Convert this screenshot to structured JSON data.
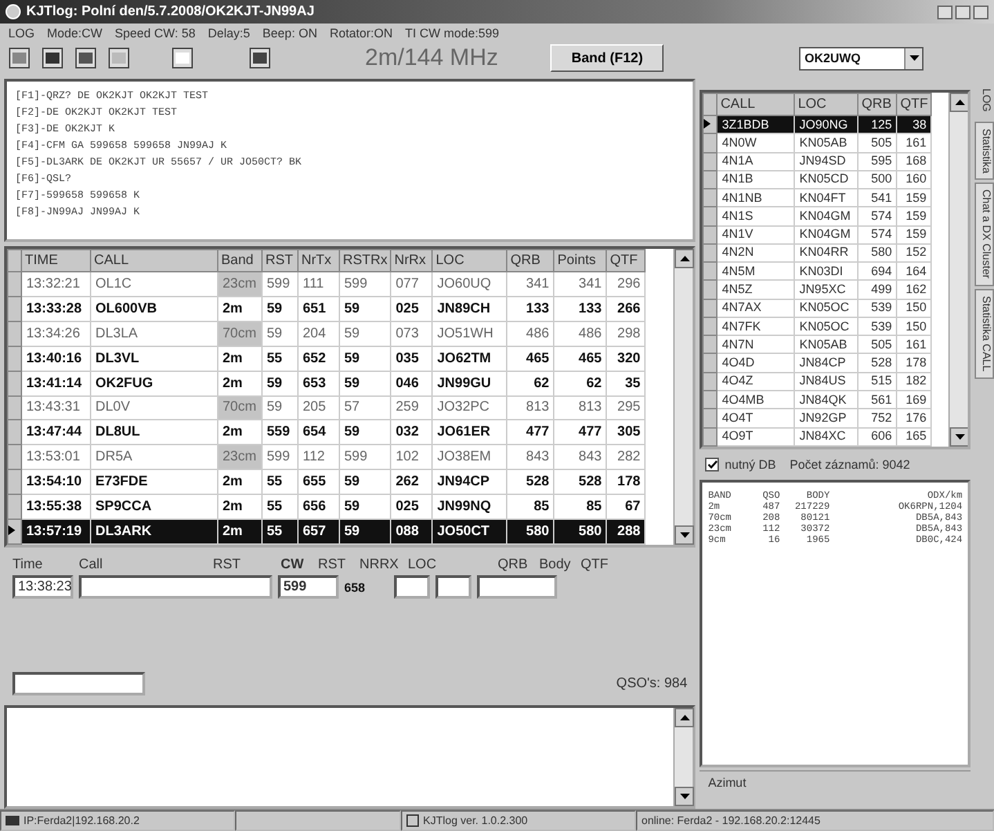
{
  "window": {
    "title": "KJTlog: Polní den/5.7.2008/OK2KJT-JN99AJ"
  },
  "menu": [
    "LOG",
    "Mode:CW",
    "Speed CW: 58",
    "Delay:5",
    "Beep: ON",
    "Rotator:ON",
    "TI CW mode:599"
  ],
  "toolbar": {
    "band_label": "2m/144 MHz",
    "band_button": "Band (F12)",
    "operator": "OK2UWQ"
  },
  "macros": [
    "[F1]-QRZ? DE OK2KJT OK2KJT TEST",
    "[F2]-DE OK2KJT OK2KJT TEST",
    "[F3]-DE OK2KJT K",
    "[F4]-CFM GA 599658 599658 JN99AJ K",
    "[F5]-DL3ARK DE OK2KJT UR 55657 / UR JO50CT? BK",
    "[F6]-QSL?",
    "[F7]-599658 599658 K",
    "[F8]-JN99AJ JN99AJ K"
  ],
  "log": {
    "columns": [
      "TIME",
      "CALL",
      "Band",
      "RST",
      "NrTx",
      "RSTRx",
      "NrRx",
      "LOC",
      "QRB",
      "Points",
      "QTF"
    ],
    "rows": [
      {
        "cells": [
          "13:32:21",
          "OL1C",
          "23cm",
          "599",
          "111",
          "599",
          "077",
          "JO60UQ",
          "341",
          "341",
          "296"
        ],
        "greyed": true,
        "selected": false
      },
      {
        "cells": [
          "13:33:28",
          "OL600VB",
          "2m",
          "59",
          "651",
          "59",
          "025",
          "JN89CH",
          "133",
          "133",
          "266"
        ],
        "greyed": false,
        "selected": false
      },
      {
        "cells": [
          "13:34:26",
          "DL3LA",
          "70cm",
          "59",
          "204",
          "59",
          "073",
          "JO51WH",
          "486",
          "486",
          "298"
        ],
        "greyed": true,
        "selected": false
      },
      {
        "cells": [
          "13:40:16",
          "DL3VL",
          "2m",
          "55",
          "652",
          "59",
          "035",
          "JO62TM",
          "465",
          "465",
          "320"
        ],
        "greyed": false,
        "selected": false
      },
      {
        "cells": [
          "13:41:14",
          "OK2FUG",
          "2m",
          "59",
          "653",
          "59",
          "046",
          "JN99GU",
          "62",
          "62",
          "35"
        ],
        "greyed": false,
        "selected": false
      },
      {
        "cells": [
          "13:43:31",
          "DL0V",
          "70cm",
          "59",
          "205",
          "57",
          "259",
          "JO32PC",
          "813",
          "813",
          "295"
        ],
        "greyed": true,
        "selected": false
      },
      {
        "cells": [
          "13:47:44",
          "DL8UL",
          "2m",
          "559",
          "654",
          "59",
          "032",
          "JO61ER",
          "477",
          "477",
          "305"
        ],
        "greyed": false,
        "selected": false
      },
      {
        "cells": [
          "13:53:01",
          "DR5A",
          "23cm",
          "599",
          "112",
          "599",
          "102",
          "JO38EM",
          "843",
          "843",
          "282"
        ],
        "greyed": true,
        "selected": false
      },
      {
        "cells": [
          "13:54:10",
          "E73FDE",
          "2m",
          "55",
          "655",
          "59",
          "262",
          "JN94CP",
          "528",
          "528",
          "178"
        ],
        "greyed": false,
        "selected": false
      },
      {
        "cells": [
          "13:55:38",
          "SP9CCA",
          "2m",
          "55",
          "656",
          "59",
          "025",
          "JN99NQ",
          "85",
          "85",
          "67"
        ],
        "greyed": false,
        "selected": false
      },
      {
        "cells": [
          "13:57:19",
          "DL3ARK",
          "2m",
          "55",
          "657",
          "59",
          "088",
          "JO50CT",
          "580",
          "580",
          "288"
        ],
        "greyed": false,
        "selected": true
      }
    ]
  },
  "entry": {
    "labels": [
      "Time",
      "Call",
      "RST",
      "CW",
      "RST",
      "NRRX",
      "LOC",
      "QRB",
      "Body",
      "QTF"
    ],
    "time": "13:38:23",
    "rst": "599",
    "nr_tx": "658",
    "qso_count": "QSO's: 984"
  },
  "calls": {
    "columns": [
      "CALL",
      "LOC",
      "QRB",
      "QTF"
    ],
    "rows": [
      {
        "cells": [
          "3Z1BDB",
          "JO90NG",
          "125",
          "38"
        ],
        "selected": true
      },
      {
        "cells": [
          "4N0W",
          "KN05AB",
          "505",
          "161"
        ],
        "selected": false
      },
      {
        "cells": [
          "4N1A",
          "JN94SD",
          "595",
          "168"
        ],
        "selected": false
      },
      {
        "cells": [
          "4N1B",
          "KN05CD",
          "500",
          "160"
        ],
        "selected": false
      },
      {
        "cells": [
          "4N1NB",
          "KN04FT",
          "541",
          "159"
        ],
        "selected": false
      },
      {
        "cells": [
          "4N1S",
          "KN04GM",
          "574",
          "159"
        ],
        "selected": false
      },
      {
        "cells": [
          "4N1V",
          "KN04GM",
          "574",
          "159"
        ],
        "selected": false
      },
      {
        "cells": [
          "4N2N",
          "KN04RR",
          "580",
          "152"
        ],
        "selected": false
      },
      {
        "cells": [
          "4N5M",
          "KN03DI",
          "694",
          "164"
        ],
        "selected": false
      },
      {
        "cells": [
          "4N5Z",
          "JN95XC",
          "499",
          "162"
        ],
        "selected": false
      },
      {
        "cells": [
          "4N7AX",
          "KN05OC",
          "539",
          "150"
        ],
        "selected": false
      },
      {
        "cells": [
          "4N7FK",
          "KN05OC",
          "539",
          "150"
        ],
        "selected": false
      },
      {
        "cells": [
          "4N7N",
          "KN05AB",
          "505",
          "161"
        ],
        "selected": false
      },
      {
        "cells": [
          "4O4D",
          "JN84CP",
          "528",
          "178"
        ],
        "selected": false
      },
      {
        "cells": [
          "4O4Z",
          "JN84US",
          "515",
          "182"
        ],
        "selected": false
      },
      {
        "cells": [
          "4O4MB",
          "JN84QK",
          "561",
          "169"
        ],
        "selected": false
      },
      {
        "cells": [
          "4O4T",
          "JN92GP",
          "752",
          "176"
        ],
        "selected": false
      },
      {
        "cells": [
          "4O9T",
          "JN84XC",
          "606",
          "165"
        ],
        "selected": false
      }
    ]
  },
  "db": {
    "label": "nutný DB",
    "checked": true,
    "count": "Počet záznamů: 9042"
  },
  "stats": {
    "columns": [
      "BAND",
      "QSO",
      "BODY",
      "ODX/km"
    ],
    "rows": [
      [
        "2m",
        "487",
        "217229",
        "OK6RPN,1204"
      ],
      [
        "70cm",
        "208",
        "80121",
        "DB5A,843"
      ],
      [
        "23cm",
        "112",
        "30372",
        "DB5A,843"
      ],
      [
        "9cm",
        "16",
        "1965",
        "DB0C,424"
      ]
    ]
  },
  "azimuth": "Azimut",
  "side_tabs": [
    {
      "label": "LOG",
      "selected": true
    },
    {
      "label": "Statistika",
      "selected": false
    },
    {
      "label": "Chat a DX Cluster",
      "selected": false
    },
    {
      "label": "Statistika CALL",
      "selected": false
    }
  ],
  "status_bar": [
    "IP:Ferda2|192.168.20.2",
    "KJTlog ver. 1.0.2.300",
    "online: Ferda2 - 192.168.20.2:12445"
  ]
}
